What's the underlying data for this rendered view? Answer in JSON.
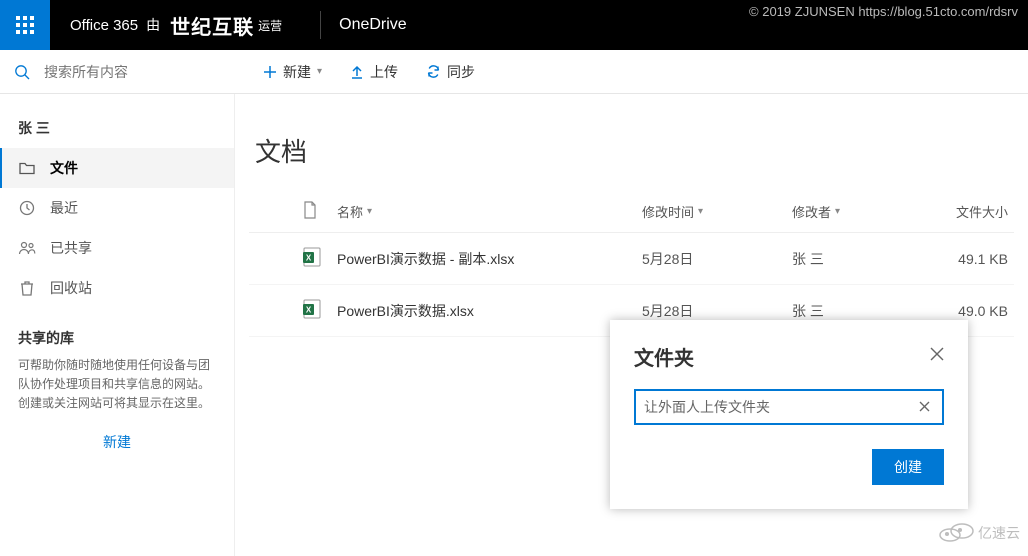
{
  "copyright": "© 2019 ZJUNSEN https://blog.51cto.com/rdsrv",
  "header": {
    "office365": "Office 365",
    "by": "由",
    "brand_cn": "世纪互联",
    "operated": "运营",
    "app": "OneDrive"
  },
  "search": {
    "placeholder": "搜索所有内容"
  },
  "commands": {
    "new": "新建",
    "upload": "上传",
    "sync": "同步"
  },
  "sidebar": {
    "user": "张 三",
    "items": [
      {
        "label": "文件"
      },
      {
        "label": "最近"
      },
      {
        "label": "已共享"
      },
      {
        "label": "回收站"
      }
    ],
    "shared_title": "共享的库",
    "shared_help": "可帮助你随时随地使用任何设备与团队协作处理项目和共享信息的网站。创建或关注网站可将其显示在这里。",
    "new": "新建"
  },
  "main": {
    "title": "文档",
    "columns": {
      "name": "名称",
      "modified": "修改时间",
      "by": "修改者",
      "size": "文件大小"
    },
    "rows": [
      {
        "name": "PowerBI演示数据 - 副本.xlsx",
        "modified": "5月28日",
        "by": "张 三",
        "size": "49.1 KB"
      },
      {
        "name": "PowerBI演示数据.xlsx",
        "modified": "5月28日",
        "by": "张 三",
        "size": "49.0 KB"
      }
    ]
  },
  "dialog": {
    "title": "文件夹",
    "input_value": "让外面人上传文件夹",
    "create": "创建"
  },
  "watermark": "亿速云"
}
